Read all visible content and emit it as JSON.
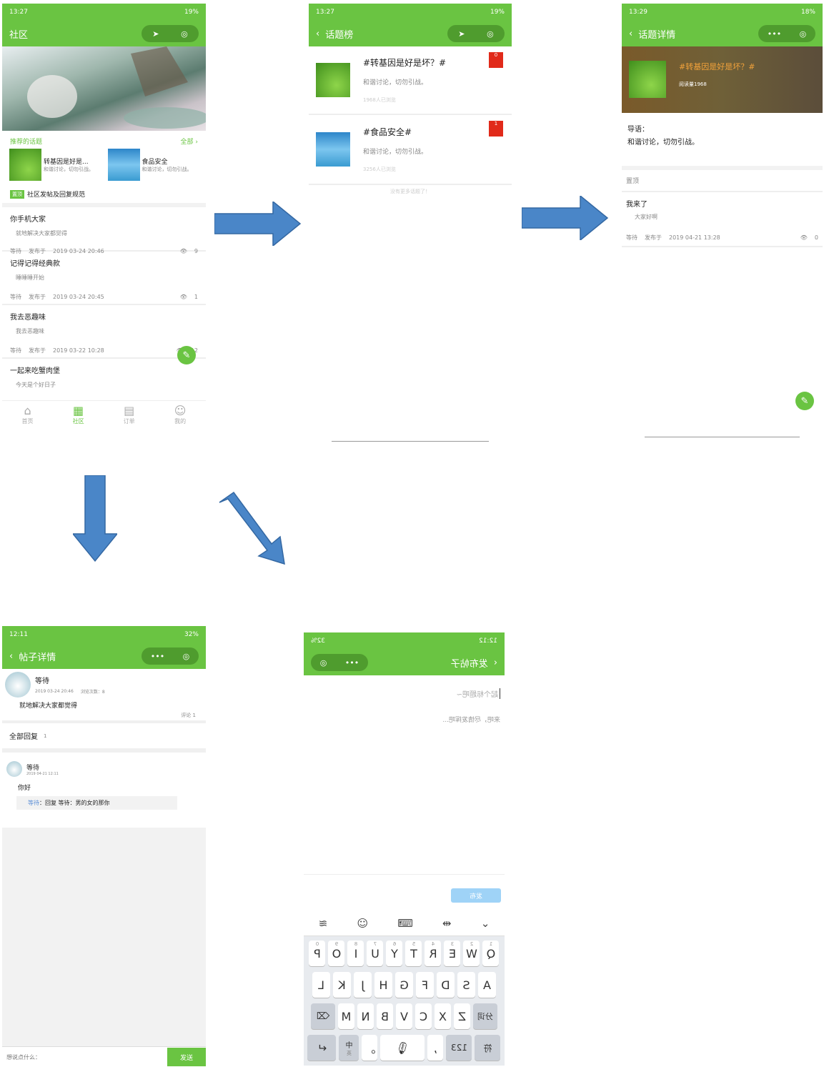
{
  "screen1": {
    "status_time": "13:27",
    "status_battery": "19%",
    "title": "社区",
    "recommended_label": "推荐的话题",
    "all_label": "全部",
    "topics": [
      {
        "title": "转基因是好是...",
        "desc": "和谐讨论，切勿引战。"
      },
      {
        "title": "食品安全",
        "desc": "和谐讨论，切勿引战。"
      }
    ],
    "pinned_badge": "置顶",
    "pinned_text": "社区发帖及回复规范",
    "posts": [
      {
        "title": "你手机大家",
        "body": "就地解决大家都觉得",
        "author": "等待",
        "published": "发布于",
        "date": "2019 03-24 20:46",
        "views": "9"
      },
      {
        "title": "记得记得经典款",
        "body": "睡睡睡开始",
        "author": "等待",
        "published": "发布于",
        "date": "2019 03-24 20:45",
        "views": "1"
      },
      {
        "title": "我去恶趣味",
        "body": "我去恶趣味",
        "author": "等待",
        "published": "发布于",
        "date": "2019 03-22 10:28",
        "views": "12"
      },
      {
        "title": "一起来吃蟹肉堡",
        "body": "今天是个好日子"
      }
    ],
    "tabs": [
      {
        "label": "首页",
        "icon": "home-icon"
      },
      {
        "label": "社区",
        "icon": "building-icon"
      },
      {
        "label": "订单",
        "icon": "document-icon"
      },
      {
        "label": "我的",
        "icon": "user-icon"
      }
    ]
  },
  "screen2": {
    "status_time": "13:27",
    "status_battery": "19%",
    "title": "话题榜",
    "items": [
      {
        "title": "#转基因是好是坏？#",
        "desc": "和谐讨论，切勿引战。",
        "views": "1968人已浏览",
        "rank": "0"
      },
      {
        "title": "#食品安全#",
        "desc": "和谐讨论，切勿引战。",
        "views": "3256人已浏览",
        "rank": "1"
      }
    ],
    "end_text": "没有更多话题了！"
  },
  "screen3": {
    "status_time": "13:29",
    "status_battery": "18%",
    "title": "话题详情",
    "banner_title": "#转基因是好是坏？#",
    "banner_reads": "阅读量1968",
    "intro_label": "导语：",
    "intro_text": "和谐讨论，切勿引战。",
    "pinned_label": "置顶",
    "post": {
      "title": "我来了",
      "body": "大家好啊",
      "author": "等待",
      "published": "发布于",
      "date": "2019 04-21 13:28",
      "views": "0"
    }
  },
  "screen4": {
    "status_time": "12:11",
    "status_battery": "32%",
    "title": "帖子详情",
    "author": "等待",
    "date": "2019 03-24 20:46",
    "views": "浏览次数：8",
    "body": "就地解决大家都觉得",
    "comment_count": "评论 1",
    "all_replies": "全部回复",
    "all_replies_count": "1",
    "reply": {
      "author": "等待",
      "date": "2019 04-21 12:11",
      "text": "你好",
      "quote_name": "等待",
      "quote_text": "：回复 等待：男的女的那你"
    },
    "input_placeholder": "想说点什么：",
    "send": "发送"
  },
  "screen5": {
    "status_time": "12:12",
    "status_battery": "32%",
    "title": "发布帖子",
    "title_placeholder": "起个标题吧~",
    "content_placeholder": "来吧，尽情发挥吧...",
    "submit": "发布",
    "kb_row1": [
      "Q",
      "W",
      "E",
      "R",
      "T",
      "Y",
      "U",
      "I",
      "O",
      "P"
    ],
    "kb_row1_sub": [
      "1",
      "2",
      "3",
      "4",
      "5",
      "6",
      "7",
      "8",
      "9",
      "0"
    ],
    "kb_row2": [
      "A",
      "S",
      "D",
      "F",
      "G",
      "H",
      "J",
      "K",
      "L"
    ],
    "kb_row3": [
      "Z",
      "X",
      "C",
      "V",
      "B",
      "N",
      "M"
    ],
    "kb_fenci": "分词",
    "kb_fu": "符",
    "kb_123": "123",
    "kb_zhong": "中",
    "kb_ying": "英"
  },
  "colors": {
    "green": "#6ac442",
    "arrow": "#4a86c8"
  }
}
